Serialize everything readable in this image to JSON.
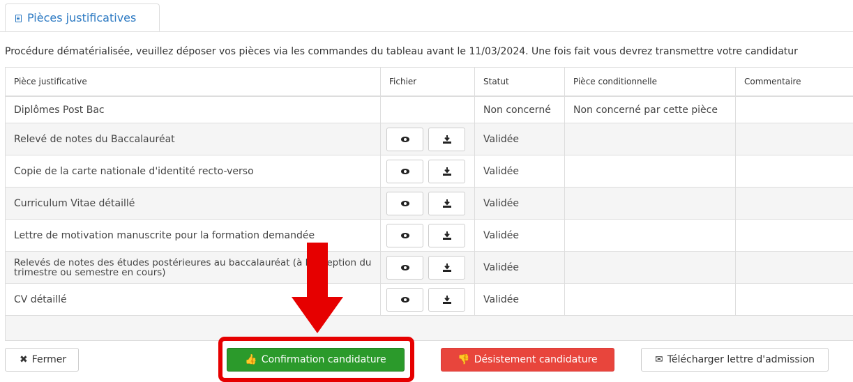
{
  "tab": {
    "label": "Pièces justificatives",
    "icon": "document-icon"
  },
  "notice": "Procédure dématérialisée, veuillez déposer vos pièces via les commandes du tableau avant le 11/03/2024. Une fois fait vous devrez transmettre votre candidatur",
  "table": {
    "headers": [
      "Pièce justificative",
      "Fichier",
      "Statut",
      "Pièce conditionnelle",
      "Commentaire"
    ],
    "rows": [
      {
        "piece": "Diplômes Post Bac",
        "statut": "Non concerné",
        "conditionnelle": "Non concerné par cette pièce",
        "commentaire": ""
      },
      {
        "piece": "Relevé de notes du Baccalauréat",
        "statut": "Validée",
        "conditionnelle": "",
        "commentaire": ""
      },
      {
        "piece": "Copie de la carte nationale d'identité recto-verso",
        "statut": "Validée",
        "conditionnelle": "",
        "commentaire": ""
      },
      {
        "piece": "Curriculum Vitae détaillé",
        "statut": "Validée",
        "conditionnelle": "",
        "commentaire": ""
      },
      {
        "piece": "Lettre de motivation manuscrite pour la formation demandée",
        "statut": "Validée",
        "conditionnelle": "",
        "commentaire": ""
      },
      {
        "piece": "Relevés de notes des études postérieures au baccalauréat (à l'exception du trimestre ou semestre en cours)",
        "statut": "Validée",
        "conditionnelle": "",
        "commentaire": ""
      },
      {
        "piece": "CV détaillé",
        "statut": "Validée",
        "conditionnelle": "",
        "commentaire": ""
      }
    ]
  },
  "buttons": {
    "close": "Fermer",
    "confirm": "Confirmation candidature",
    "withdraw": "Désistement candidature",
    "download_letter": "Télécharger lettre d'admission"
  },
  "colors": {
    "accent": "#2a78c2",
    "confirm": "#2b9a2b",
    "withdraw": "#e8453c",
    "annotation": "#e60000"
  }
}
